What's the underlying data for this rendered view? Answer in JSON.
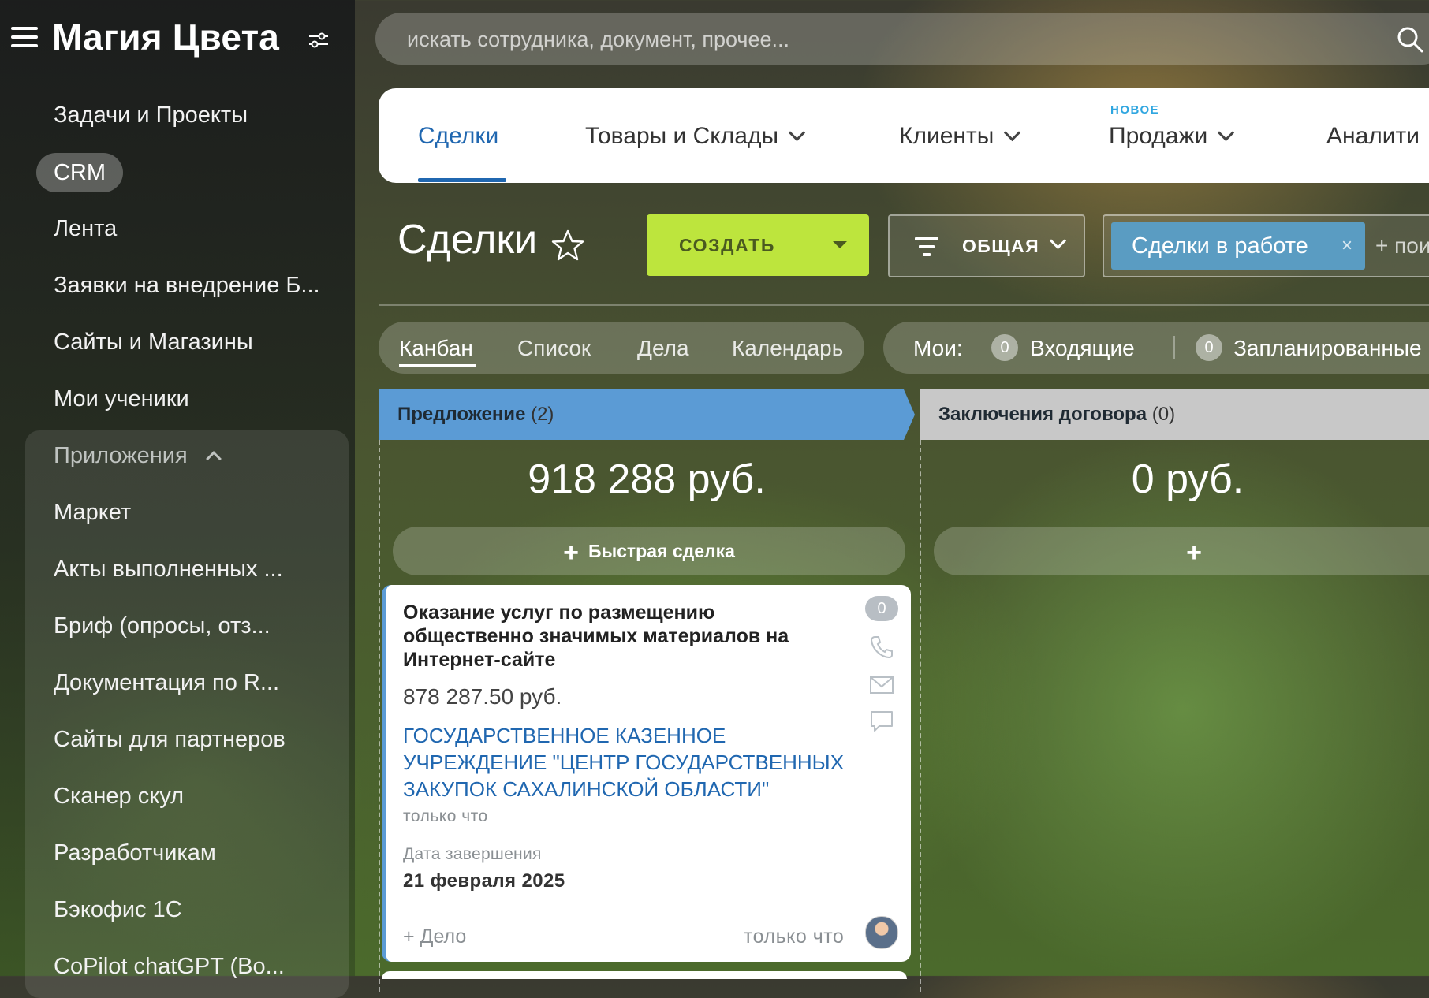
{
  "app": {
    "title": "Магия Цвета"
  },
  "sidebar": {
    "items": [
      {
        "label": "Задачи и Проекты"
      },
      {
        "label": "CRM"
      },
      {
        "label": "Лента"
      },
      {
        "label": "Заявки на внедрение Б..."
      },
      {
        "label": "Сайты и Магазины"
      },
      {
        "label": "Мои ученики"
      }
    ],
    "apps_header": "Приложения",
    "apps": [
      {
        "label": "Маркет"
      },
      {
        "label": "Акты выполненных ..."
      },
      {
        "label": "Бриф (опросы, отз..."
      },
      {
        "label": "Документация по R..."
      },
      {
        "label": "Сайты для партнеров"
      },
      {
        "label": "Сканер скул"
      },
      {
        "label": "Разработчикам"
      },
      {
        "label": "Бэкофис 1С"
      },
      {
        "label": "CoPilot chatGPT (Bo..."
      }
    ]
  },
  "search": {
    "placeholder": "искать сотрудника, документ, прочее..."
  },
  "tabs": [
    {
      "label": "Сделки"
    },
    {
      "label": "Товары и Склады"
    },
    {
      "label": "Клиенты"
    },
    {
      "label": "Продажи",
      "badge": "НОВОЕ"
    },
    {
      "label": "Аналити"
    }
  ],
  "page": {
    "title": "Сделки"
  },
  "toolbar": {
    "create_label": "СОЗДАТЬ",
    "filter_label": "ОБЩАЯ",
    "preset_chip": "Сделки в работе",
    "preset_remove": "×",
    "preset_add": "+ пои"
  },
  "views": [
    {
      "label": "Канбан"
    },
    {
      "label": "Список"
    },
    {
      "label": "Дела"
    },
    {
      "label": "Календарь"
    }
  ],
  "counters": {
    "label": "Мои:",
    "items": [
      {
        "count": "0",
        "label": "Входящие"
      },
      {
        "count": "0",
        "label": "Запланированные"
      }
    ]
  },
  "columns": [
    {
      "title": "Предложение",
      "count": "(2)",
      "sum": "918 288 руб.",
      "quick_label": "Быстрая сделка",
      "color": "#5b9bd5"
    },
    {
      "title": "Заключения договора",
      "count": "(0)",
      "sum": "0 руб.",
      "quick_label": "",
      "color": "#c8c8c8"
    }
  ],
  "deal_card": {
    "title": "Оказание услуг по размещению общественно значимых материалов на Интернет-сайте",
    "amount": "878 287.50 руб.",
    "client": "ГОСУДАРСТВЕННОЕ КАЗЕННОЕ УЧРЕЖДЕНИЕ \"ЦЕНТР ГОСУДАРСТВЕННЫХ ЗАКУПОК САХАЛИНСКОЙ ОБЛАСТИ\"",
    "created": "только что",
    "close_date_label": "Дата завершения",
    "close_date": "21 февраля 2025",
    "add_activity": "+ Дело",
    "updated": "только что",
    "counter": "0"
  },
  "colors": {
    "accent": "#2067b0",
    "create": "#bde53d",
    "chip": "#5a9cc2"
  }
}
